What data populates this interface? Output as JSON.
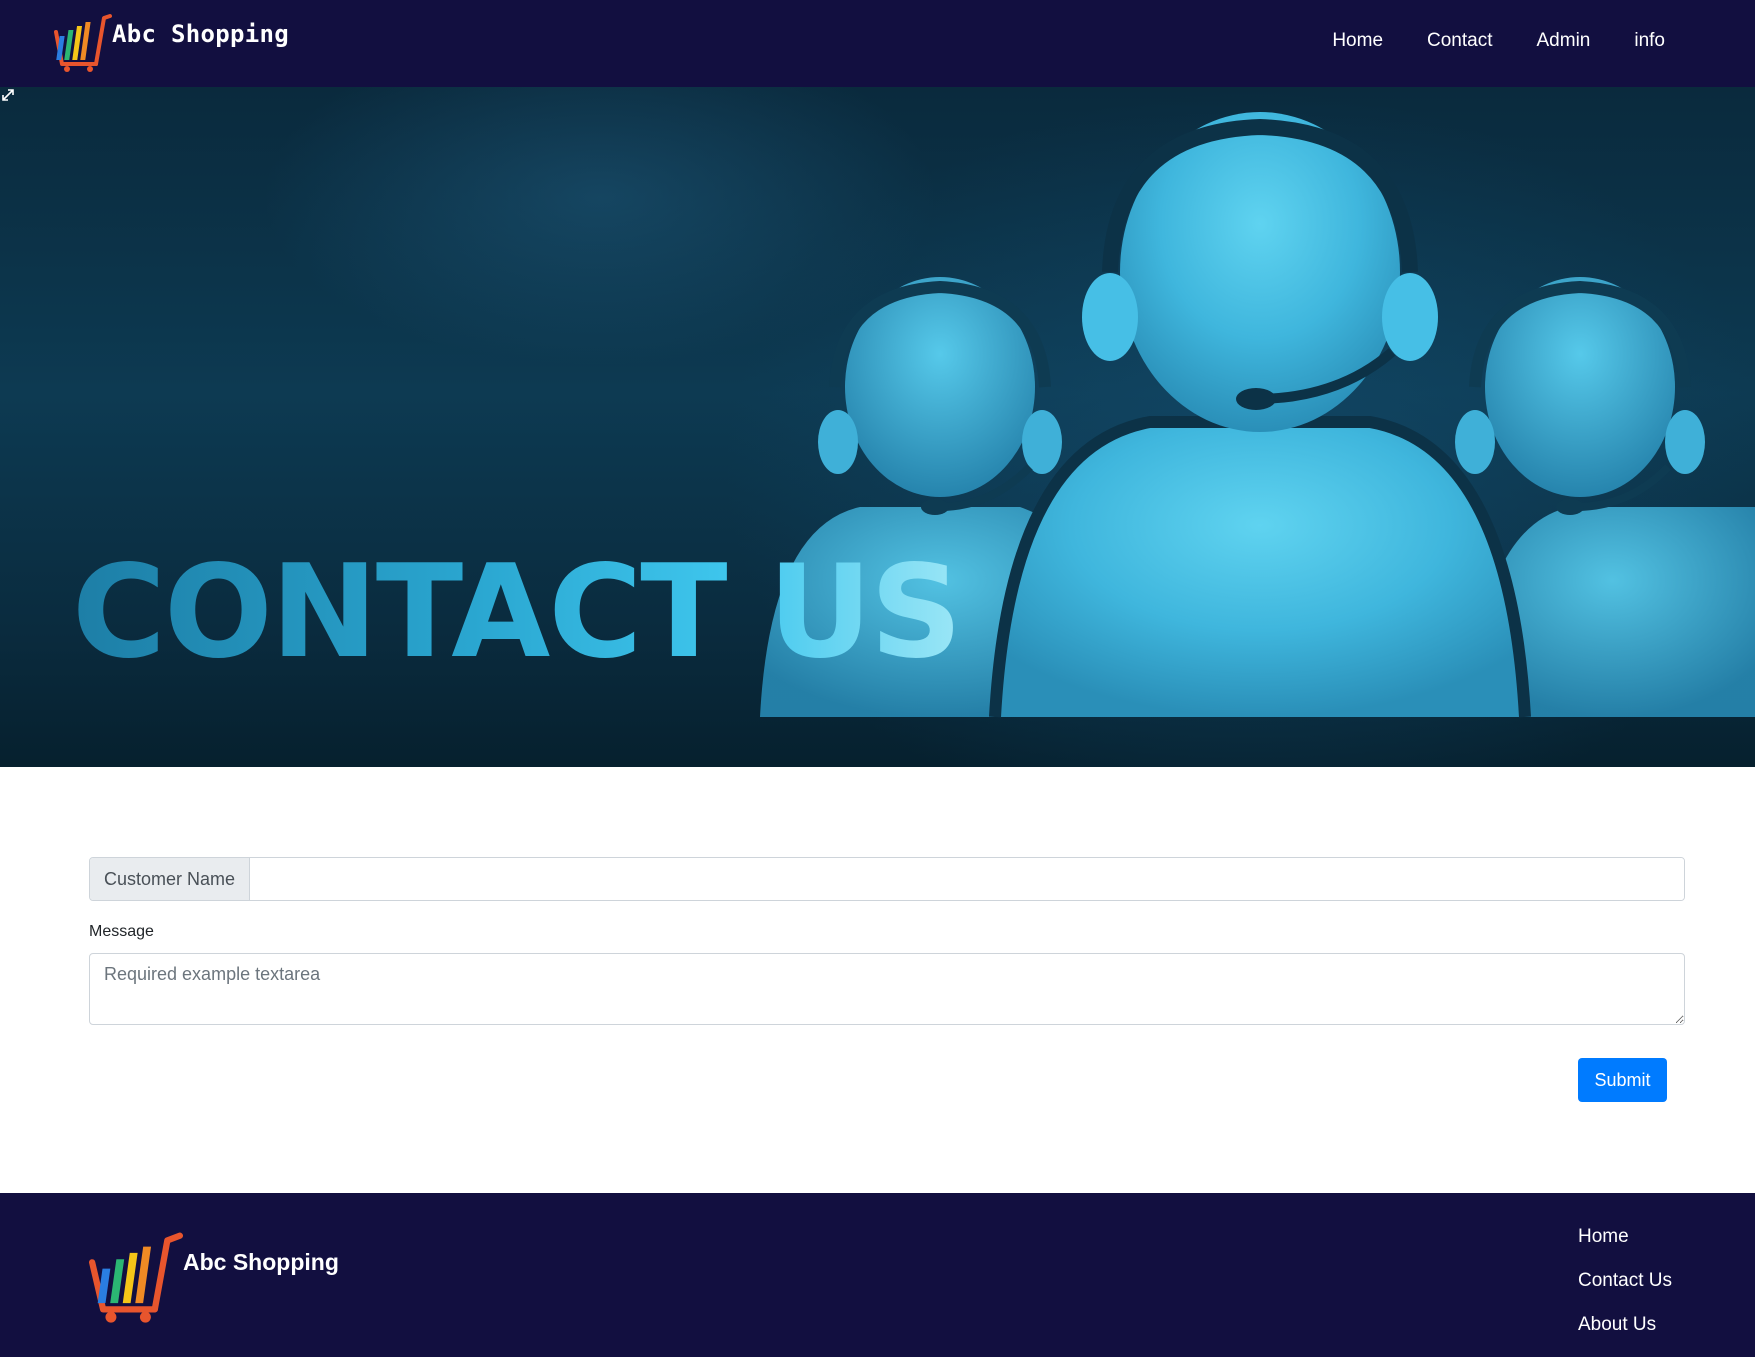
{
  "header": {
    "brand": "Abc Shopping",
    "nav": [
      "Home",
      "Contact",
      "Admin",
      "info"
    ]
  },
  "hero": {
    "title": "CONTACT US"
  },
  "form": {
    "name_label": "Customer Name",
    "name_value": "",
    "message_label": "Message",
    "message_placeholder": "Required example textarea",
    "submit_label": "Submit"
  },
  "footer": {
    "brand": "Abc Shopping",
    "links": [
      "Home",
      "Contact Us",
      "About Us"
    ]
  },
  "colors": {
    "navbar_bg": "#120f40",
    "primary_button": "#007bff",
    "hero_accent": "#3fc7ee"
  },
  "icons": [
    "shopping-cart-logo",
    "expand-icon"
  ]
}
